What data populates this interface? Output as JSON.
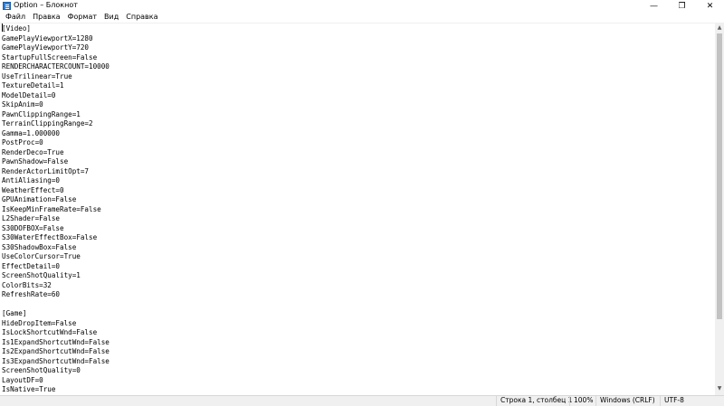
{
  "window": {
    "title": "Option – Блокнот",
    "icon": "notepad-icon",
    "controls": {
      "minimize": "—",
      "maximize": "❐",
      "close": "✕"
    }
  },
  "menu": [
    "Файл",
    "Правка",
    "Формат",
    "Вид",
    "Справка"
  ],
  "editor": {
    "lines": [
      "[Video]",
      "GamePlayViewportX=1280",
      "GamePlayViewportY=720",
      "StartupFullScreen=False",
      "RENDERCHARACTERCOUNT=10000",
      "UseTrilinear=True",
      "TextureDetail=1",
      "ModelDetail=0",
      "SkipAnim=0",
      "PawnClippingRange=1",
      "TerrainClippingRange=2",
      "Gamma=1.000000",
      "PostProc=0",
      "RenderDeco=True",
      "PawnShadow=False",
      "RenderActorLimitOpt=7",
      "AntiAliasing=0",
      "WeatherEffect=0",
      "GPUAnimation=False",
      "IsKeepMinFrameRate=False",
      "L2Shader=False",
      "S30DOFBOX=False",
      "S30WaterEffectBox=False",
      "S30ShadowBox=False",
      "UseColorCursor=True",
      "EffectDetail=0",
      "ScreenShotQuality=1",
      "ColorBits=32",
      "RefreshRate=60",
      "",
      "[Game]",
      "HideDropItem=False",
      "IsLockShortcutWnd=False",
      "Is1ExpandShortcutWnd=False",
      "Is2ExpandShortcutWnd=False",
      "Is3ExpandShortcutWnd=False",
      "ScreenShotQuality=0",
      "LayoutDF=0",
      "IsNative=True"
    ]
  },
  "statusbar": {
    "position": "Строка 1, столбец 1",
    "zoom": "100%",
    "line_endings": "Windows (CRLF)",
    "encoding": "UTF-8"
  }
}
